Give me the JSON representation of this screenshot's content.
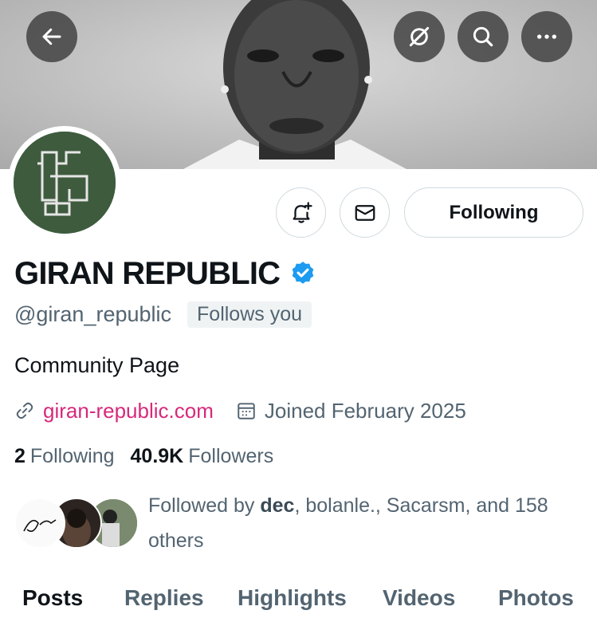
{
  "header": {
    "back_icon": "arrow-left-icon",
    "grok_icon": "grok-icon",
    "search_icon": "search-icon",
    "more_icon": "more-horizontal-icon"
  },
  "profile": {
    "name": "GIRAN REPUBLIC",
    "verified": true,
    "handle": "@giran_republic",
    "follows_you": "Follows you",
    "bio": "Community Page",
    "website": "giran-republic.com",
    "joined": "Joined February 2025"
  },
  "actions": {
    "notify_icon": "bell-plus-icon",
    "message_icon": "envelope-icon",
    "following_label": "Following"
  },
  "stats": {
    "following_count": "2",
    "following_label": "Following",
    "followers_count": "40.9K",
    "followers_label": "Followers"
  },
  "followed_by": {
    "prefix": "Followed by ",
    "first": "dec",
    "rest": ", bolanle., Sacarsm, and 158 others"
  },
  "tabs": [
    {
      "label": "Posts",
      "active": true
    },
    {
      "label": "Replies",
      "active": false
    },
    {
      "label": "Highlights",
      "active": false
    },
    {
      "label": "Videos",
      "active": false
    },
    {
      "label": "Photos",
      "active": false
    }
  ],
  "colors": {
    "accent": "#1d9bf0",
    "link": "#d6297a",
    "secondary_text": "#536471"
  }
}
